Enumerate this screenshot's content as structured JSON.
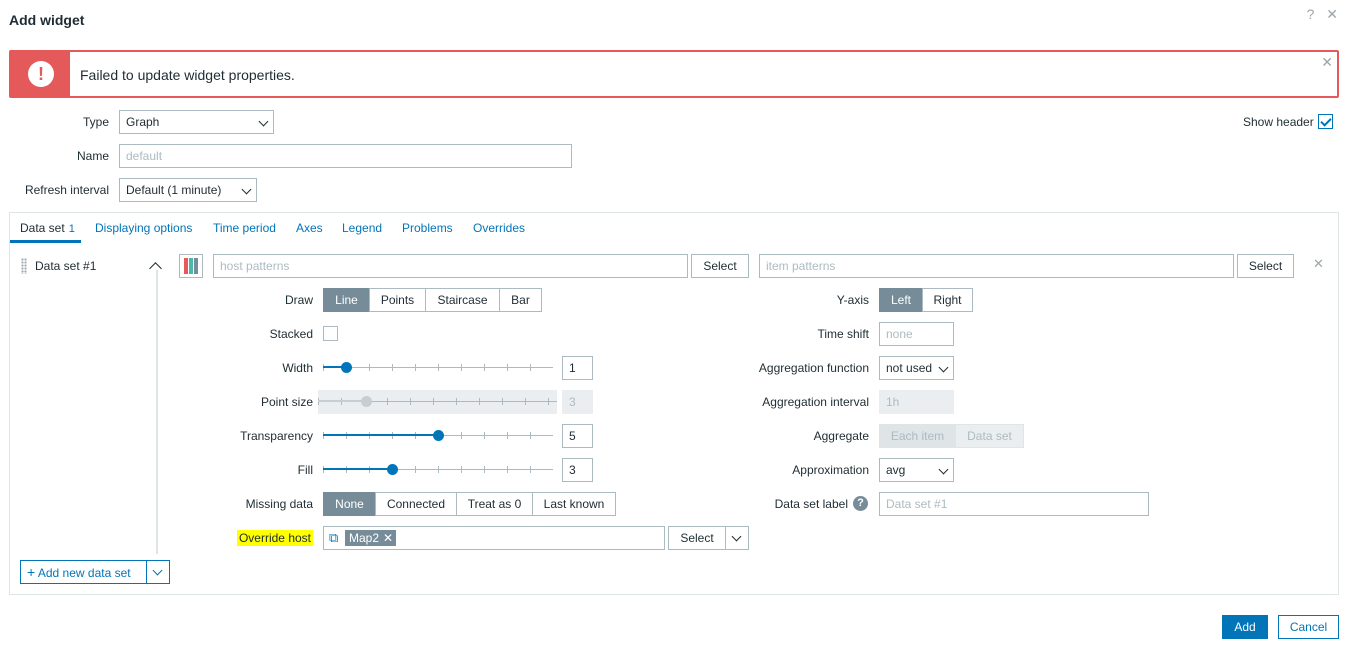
{
  "dialog": {
    "title": "Add widget",
    "help_icon": "?",
    "close_icon": "✕"
  },
  "alert": {
    "icon": "!",
    "message": "Failed to update widget properties.",
    "close": "✕"
  },
  "form": {
    "type_label": "Type",
    "type_value": "Graph",
    "name_label": "Name",
    "name_placeholder": "default",
    "refresh_label": "Refresh interval",
    "refresh_value": "Default (1 minute)",
    "show_header_label": "Show header",
    "show_header_checked": true
  },
  "tabs": [
    {
      "label": "Data set",
      "count": "1",
      "active": true
    },
    {
      "label": "Displaying options"
    },
    {
      "label": "Time period"
    },
    {
      "label": "Axes"
    },
    {
      "label": "Legend"
    },
    {
      "label": "Problems"
    },
    {
      "label": "Overrides"
    }
  ],
  "dataset": {
    "title": "Data set #1",
    "swatch_colors": [
      "#e45959",
      "#4db6ac",
      "#768d99"
    ],
    "host_placeholder": "host patterns",
    "item_placeholder": "item patterns",
    "select_label": "Select",
    "remove": "✕",
    "draw_label": "Draw",
    "draw_options": [
      "Line",
      "Points",
      "Staircase",
      "Bar"
    ],
    "draw_selected": "Line",
    "stacked_label": "Stacked",
    "width_label": "Width",
    "width_value": "1",
    "width_fraction": 0.1,
    "point_size_label": "Point size",
    "point_size_value": "3",
    "point_size_fraction": 0.2,
    "transparency_label": "Transparency",
    "transparency_value": "5",
    "transparency_fraction": 0.5,
    "fill_label": "Fill",
    "fill_value": "3",
    "fill_fraction": 0.3,
    "missing_label": "Missing data",
    "missing_options": [
      "None",
      "Connected",
      "Treat as 0",
      "Last known"
    ],
    "missing_selected": "None",
    "override_host_label": "Override host",
    "override_host_tag": "Map2",
    "yaxis_label": "Y-axis",
    "yaxis_options": [
      "Left",
      "Right"
    ],
    "yaxis_selected": "Left",
    "timeshift_label": "Time shift",
    "timeshift_placeholder": "none",
    "aggfunc_label": "Aggregation function",
    "aggfunc_value": "not used",
    "agginterval_label": "Aggregation interval",
    "agginterval_value": "1h",
    "aggregate_label": "Aggregate",
    "aggregate_options": [
      "Each item",
      "Data set"
    ],
    "aggregate_selected": "Each item",
    "approx_label": "Approximation",
    "approx_value": "avg",
    "dslabel_label": "Data set label",
    "dslabel_help": "?",
    "dslabel_placeholder": "Data set #1"
  },
  "add_dataset_label": "Add new data set",
  "footer": {
    "add_label": "Add",
    "cancel_label": "Cancel"
  }
}
